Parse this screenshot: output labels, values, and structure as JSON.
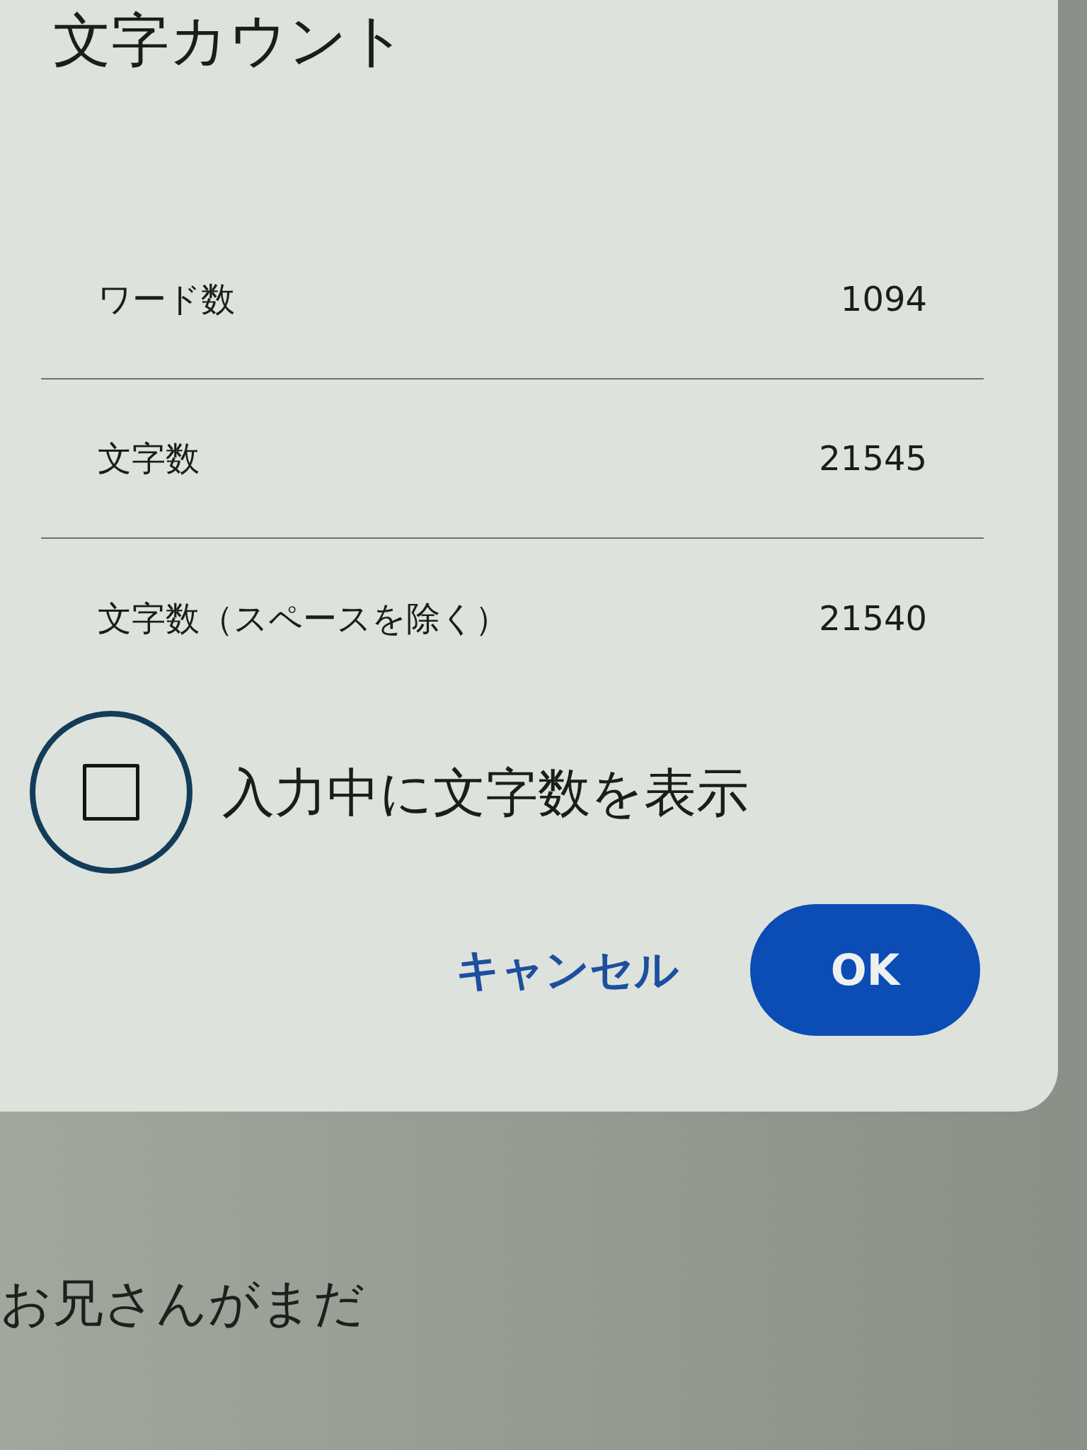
{
  "dialog": {
    "title": "文字カウント",
    "stats": [
      {
        "label": "ワード数",
        "value": "1094"
      },
      {
        "label": "文字数",
        "value": "21545"
      },
      {
        "label": "文字数（スペースを除く）",
        "value": "21540"
      }
    ],
    "checkbox": {
      "label": "入力中に文字数を表示",
      "checked": false,
      "focused": true
    },
    "buttons": [
      {
        "label": "キャンセル",
        "kind": "text"
      },
      {
        "label": "OK",
        "kind": "filled"
      }
    ]
  },
  "document": {
    "text": "お兄さんがまだ"
  }
}
